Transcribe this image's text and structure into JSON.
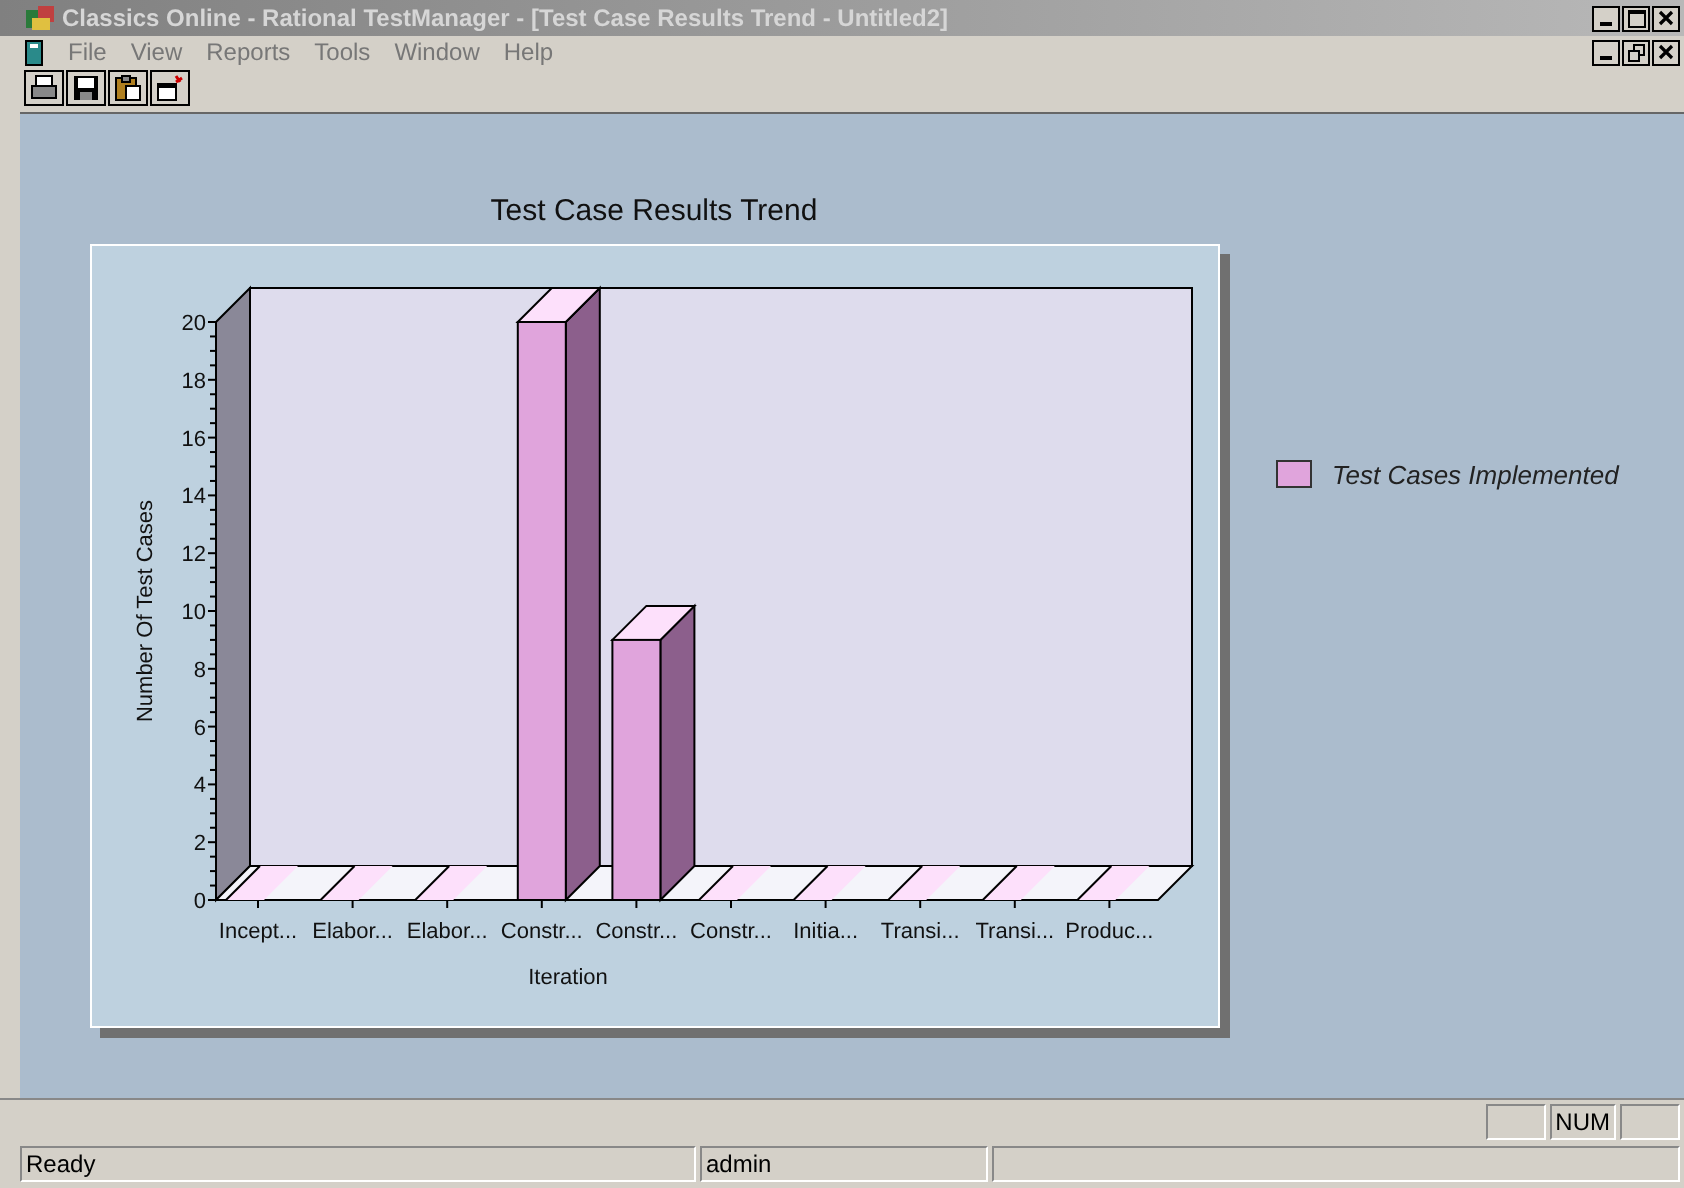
{
  "window": {
    "title": "Classics Online - Rational TestManager - [Test Case Results Trend  - Untitled2]"
  },
  "menu": [
    "File",
    "View",
    "Reports",
    "Tools",
    "Window",
    "Help"
  ],
  "chart": {
    "title": "Test Case Results Trend",
    "chart_data": {
      "type": "bar",
      "xlabel": "Iteration",
      "ylabel": "Number Of Test Cases",
      "categories": [
        "Incept...",
        "Elabor...",
        "Elabor...",
        "Constr...",
        "Constr...",
        "Constr...",
        "Initia...",
        "Transi...",
        "Transi...",
        "Produc..."
      ],
      "series": [
        {
          "name": "Test Cases Implemented",
          "color": "#e0a4dc",
          "values": [
            0,
            0,
            0,
            20,
            9,
            0,
            0,
            0,
            0,
            0
          ]
        }
      ],
      "ylim": [
        0,
        20
      ],
      "yticks": [
        0,
        2,
        4,
        6,
        8,
        10,
        12,
        14,
        16,
        18,
        20
      ]
    }
  },
  "indicators": [
    "NUM"
  ],
  "status_bar": [
    "Ready",
    "admin"
  ]
}
